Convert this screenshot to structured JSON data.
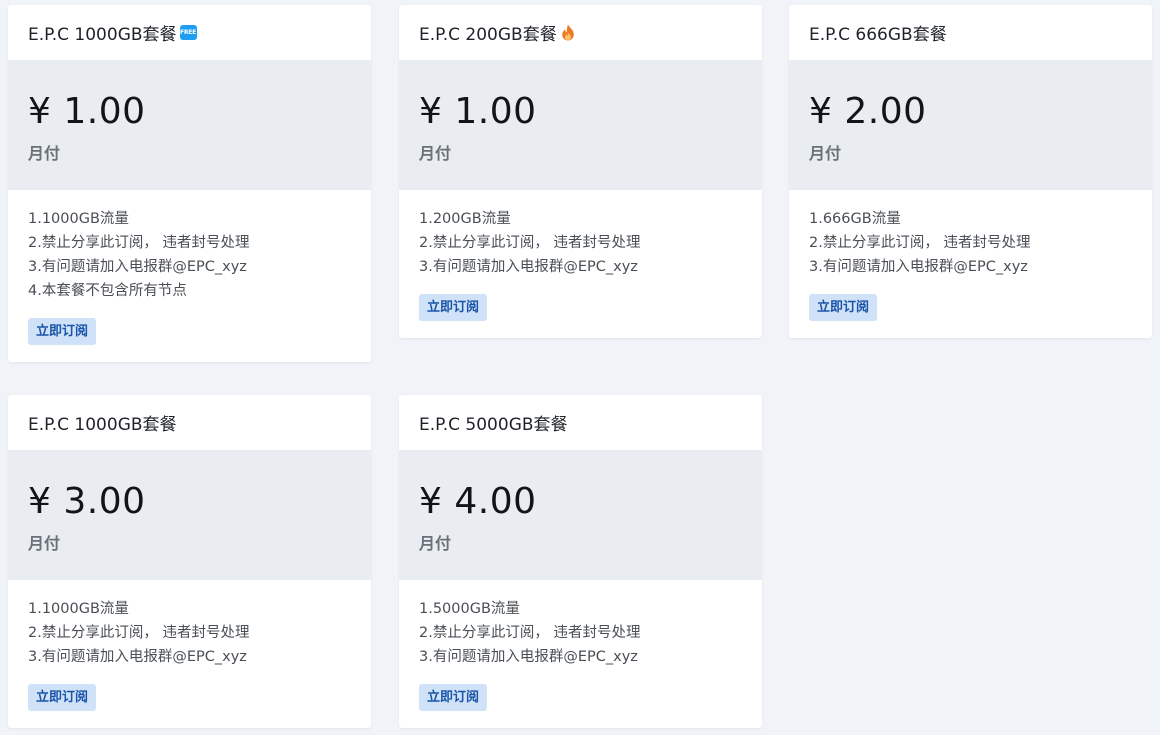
{
  "plans": [
    {
      "title": "E.P.C 1000GB套餐",
      "badge": "FREE",
      "price": "¥ 1.00",
      "period": "月付",
      "features": [
        "1.1000GB流量",
        "2.禁止分享此订阅， 违者封号处理",
        "3.有问题请加入电报群@EPC_xyz",
        "4.本套餐不包含所有节点"
      ],
      "button_label": "立即订阅"
    },
    {
      "title": "E.P.C 200GB套餐",
      "icon": "fire-icon",
      "price": "¥ 1.00",
      "period": "月付",
      "features": [
        "1.200GB流量",
        "2.禁止分享此订阅， 违者封号处理",
        "3.有问题请加入电报群@EPC_xyz"
      ],
      "button_label": "立即订阅"
    },
    {
      "title": "E.P.C 666GB套餐",
      "price": "¥ 2.00",
      "period": "月付",
      "features": [
        "1.666GB流量",
        "2.禁止分享此订阅， 违者封号处理",
        "3.有问题请加入电报群@EPC_xyz"
      ],
      "button_label": "立即订阅"
    },
    {
      "title": "E.P.C 1000GB套餐",
      "price": "¥ 3.00",
      "period": "月付",
      "features": [
        "1.1000GB流量",
        "2.禁止分享此订阅， 违者封号处理",
        "3.有问题请加入电报群@EPC_xyz"
      ],
      "button_label": "立即订阅"
    },
    {
      "title": "E.P.C 5000GB套餐",
      "price": "¥ 4.00",
      "period": "月付",
      "features": [
        "1.5000GB流量",
        "2.禁止分享此订阅， 违者封号处理",
        "3.有问题请加入电报群@EPC_xyz"
      ],
      "button_label": "立即订阅"
    }
  ],
  "colors": {
    "page_background": "#f0f3f8",
    "price_background": "#e9ecf0",
    "button_background": "#cfe2f7",
    "button_text": "#1a54a8",
    "free_badge": "#1e9ef0",
    "fire": "#f07a22"
  }
}
